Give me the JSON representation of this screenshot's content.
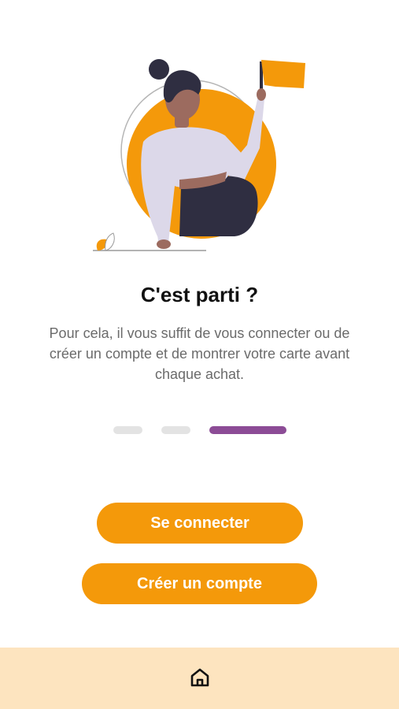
{
  "onboarding": {
    "title": "C'est parti ?",
    "description": "Pour cela, il vous suffit de vous connecter ou de créer un compte et de montrer votre carte avant chaque achat.",
    "page_indicator": {
      "total": 3,
      "current": 3
    }
  },
  "actions": {
    "login_label": "Se connecter",
    "signup_label": "Créer un compte"
  },
  "bottom_nav": {
    "items": [
      {
        "icon": "home-icon"
      }
    ]
  },
  "colors": {
    "accent": "#f4990a",
    "active_indicator": "#8c4c96",
    "bottom_bar": "#fde4bf"
  }
}
